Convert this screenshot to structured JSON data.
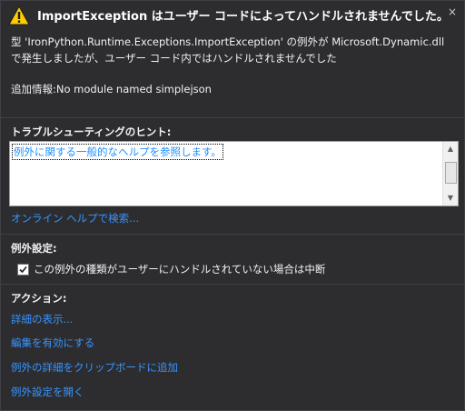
{
  "header": {
    "title": "ImportException はユーザー コードによってハンドルされませんでした。",
    "close_glyph": "×"
  },
  "message": {
    "line1": "型 'IronPython.Runtime.Exceptions.ImportException' の例外が Microsoft.Dynamic.dll",
    "line2": "で発生しましたが、ユーザー コード内ではハンドルされませんでした",
    "additional_info": "追加情報:No module named simplejson"
  },
  "troubleshooting": {
    "title": "トラブルシューティングのヒント:",
    "tip_link": "例外に関する一般的なヘルプを参照します。",
    "online_help_link": "オンライン ヘルプで検索..."
  },
  "exception_settings": {
    "title": "例外設定:",
    "checkbox_label": "この例外の種類がユーザーにハンドルされていない場合は中断",
    "checked": true
  },
  "actions": {
    "title": "アクション:",
    "items": [
      "詳細の表示...",
      "編集を有効にする",
      "例外の詳細をクリップボードに追加",
      "例外設定を開く"
    ]
  },
  "colors": {
    "background": "#2d2d30",
    "link": "#3794ff",
    "warning": "#ffcc00"
  },
  "icons": {
    "warning": "warning-icon",
    "close": "close-icon",
    "check": "check-icon"
  }
}
